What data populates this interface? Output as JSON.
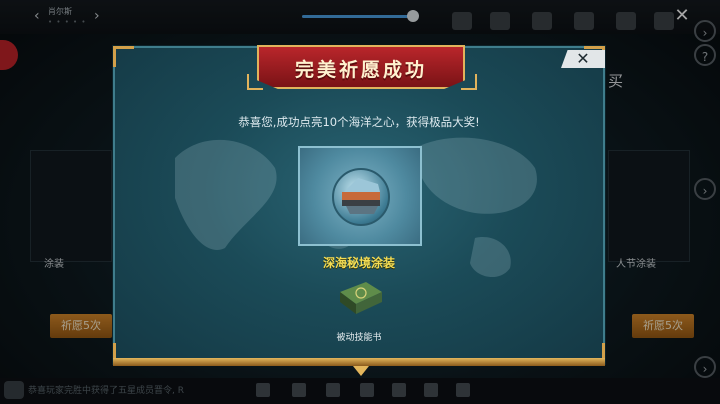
{
  "topbar": {
    "player_name": "肖尔斯",
    "player_dots": "• • • • •",
    "prev_arrow": "‹",
    "next_arrow": "›",
    "close_symbol": "✕"
  },
  "slider": {
    "level": 0.99
  },
  "background": {
    "left_btn_label": "祈愿5次",
    "right_btn_label": "祈愿5次",
    "left_card_label": "涂装",
    "right_card_label": "人节涂装",
    "side_text": "买"
  },
  "bottombar": {
    "chat_text": "恭喜玩家完胜中获得了五星成员晋令, R"
  },
  "dialog": {
    "title": "完美祈愿成功",
    "close_symbol": "✕",
    "message": "恭喜您,成功点亮10个海洋之心，获得极品大奖!",
    "reward_name": "深海秘境涂装",
    "secondary_name": "被动技能书"
  },
  "colors": {
    "title_red": "#b9262b",
    "gold": "#e1b35c",
    "reward_yellow": "#f2dc55",
    "dialog_teal": "#1b4b58"
  }
}
